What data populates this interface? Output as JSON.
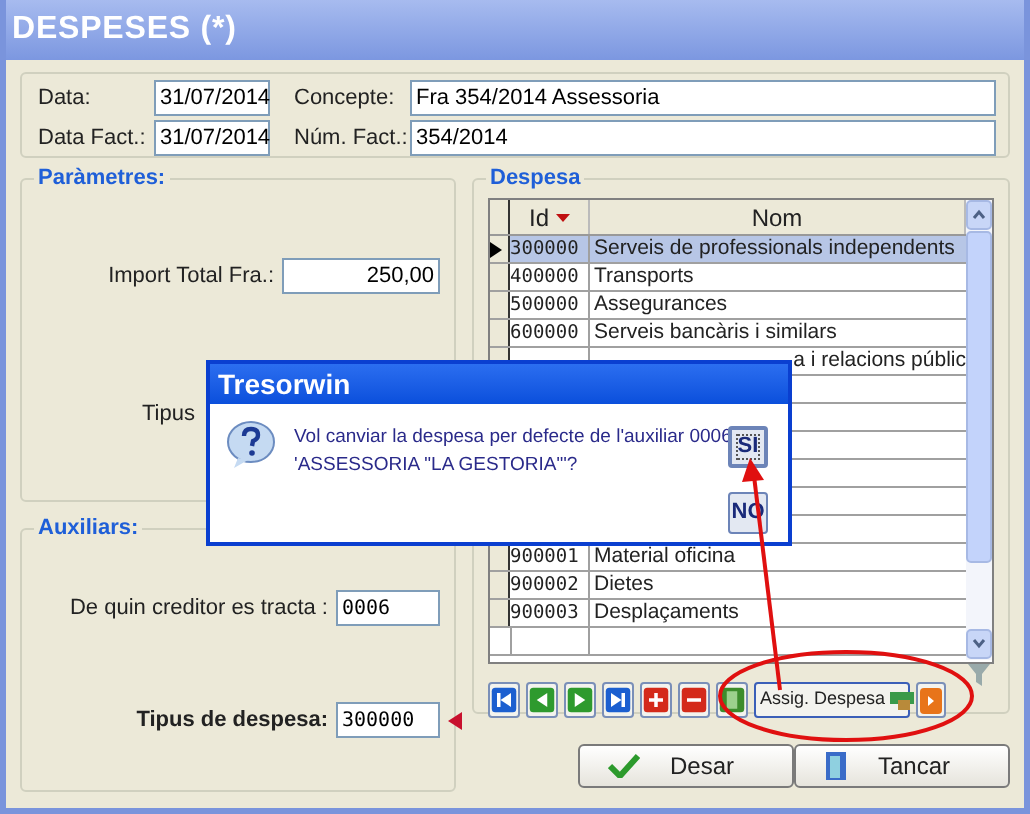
{
  "window": {
    "title": "DESPESES (*)"
  },
  "header": {
    "fields": [
      {
        "label": "Data:",
        "value": "31/07/2014"
      },
      {
        "label": "Concepte:",
        "value": "Fra 354/2014 Assessoria"
      },
      {
        "label": "Data Fact.:",
        "value": "31/07/2014"
      },
      {
        "label": "Núm. Fact.:",
        "value": "354/2014"
      }
    ]
  },
  "parametres": {
    "title": "Paràmetres:",
    "import_label": "Import Total Fra.:",
    "import_value": "250,00",
    "tipus_label": "Tipus"
  },
  "auxiliars": {
    "title": "Auxiliars:",
    "creditor_label": "De quin creditor es tracta :",
    "creditor_value": "0006",
    "tipus_label": "Tipus de despesa:",
    "tipus_value": "300000"
  },
  "despesa": {
    "title": "Despesa",
    "columns": [
      {
        "label": "Id",
        "sorted": true
      },
      {
        "label": "Nom",
        "sorted": false
      }
    ],
    "rows": [
      {
        "kind": "full",
        "id": "300000",
        "nom": "Serveis de professionals independents",
        "selected": true
      },
      {
        "kind": "full",
        "id": "400000",
        "nom": "Transports",
        "selected": false
      },
      {
        "kind": "full",
        "id": "500000",
        "nom": "Assegurances",
        "selected": false
      },
      {
        "kind": "full",
        "id": "600000",
        "nom": "Serveis bancàris i similars",
        "selected": false
      },
      {
        "kind": "partial",
        "nom": "a i relacions públic",
        "selected": false
      },
      {
        "kind": "hidden"
      },
      {
        "kind": "hidden"
      },
      {
        "kind": "hidden"
      },
      {
        "kind": "hidden"
      },
      {
        "kind": "hidden"
      },
      {
        "kind": "hidden"
      },
      {
        "kind": "full",
        "id": "900001",
        "nom": "Material oficina",
        "selected": false
      },
      {
        "kind": "full",
        "id": "900002",
        "nom": "Dietes",
        "selected": false
      },
      {
        "kind": "full",
        "id": "900003",
        "nom": "Desplaçaments",
        "selected": false
      }
    ],
    "toolbar": [
      {
        "kind": "first",
        "color": "#1c5fd0"
      },
      {
        "kind": "prev",
        "color": "#2e9a2e"
      },
      {
        "kind": "next",
        "color": "#2e9a2e"
      },
      {
        "kind": "last",
        "color": "#1c5fd0"
      },
      {
        "kind": "add",
        "color": "#d42a1a"
      },
      {
        "kind": "delete",
        "color": "#d42a1a"
      },
      {
        "kind": "edit",
        "color": "#3c8c2c"
      }
    ],
    "assign_button": "Assig. Despesa",
    "extra_button": {
      "color": "#e8741a"
    }
  },
  "buttons": [
    {
      "kind": "save",
      "label": "Desar"
    },
    {
      "kind": "close",
      "label": "Tancar"
    }
  ],
  "dialog": {
    "title": "Tresorwin",
    "message_lines": [
      "Vol canviar la despesa per defecte de l'auxiliar 0006",
      "'ASSESSORIA \"LA GESTORIA\"'?"
    ],
    "buttons": [
      {
        "label": "SI",
        "focused": true
      },
      {
        "label": "NO",
        "focused": false
      }
    ]
  }
}
